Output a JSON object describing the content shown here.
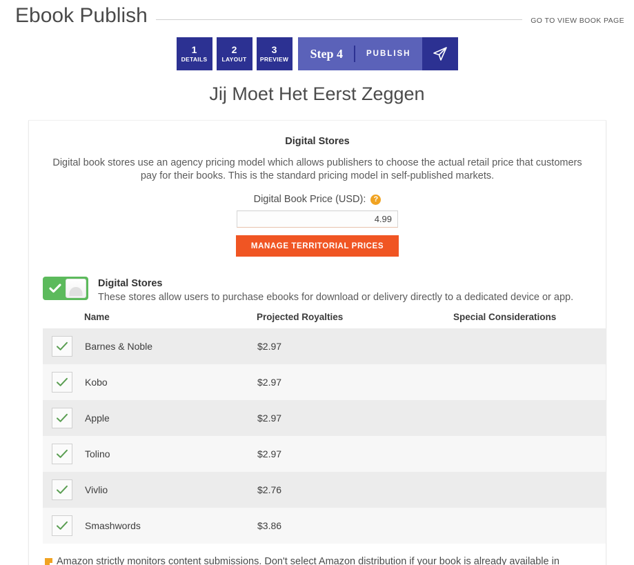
{
  "header": {
    "app_title": "Ebook Publish",
    "view_book_link": "GO TO VIEW BOOK PAGE"
  },
  "steps": {
    "items": [
      {
        "num": "1",
        "label": "DETAILS"
      },
      {
        "num": "2",
        "label": "LAYOUT"
      },
      {
        "num": "3",
        "label": "PREVIEW"
      }
    ],
    "active": {
      "word": "Step 4",
      "label": "PUBLISH",
      "icon": "paper-plane-icon"
    }
  },
  "book": {
    "title": "Jij Moet Het Eerst Zeggen"
  },
  "digital_stores_section": {
    "title": "Digital Stores",
    "description": "Digital book stores use an agency pricing model which allows publishers to choose the actual retail price that customers pay for their books. This is the standard pricing model in self-published markets.",
    "price_label": "Digital Book Price (USD):",
    "help_icon": "question-mark-icon",
    "price_value": "4.99",
    "price_placeholder": "0.00",
    "manage_button": "MANAGE TERRITORIAL PRICES"
  },
  "store_group": {
    "toggle_state": "on",
    "title": "Digital Stores",
    "subtitle": "These stores allow users to purchase ebooks for download or delivery directly to a dedicated device or app.",
    "columns": [
      "",
      "Name",
      "Projected Royalties",
      "Special Considerations"
    ],
    "rows": [
      {
        "checked": true,
        "name": "Barnes & Noble",
        "royalties": "$2.97",
        "special": ""
      },
      {
        "checked": true,
        "name": "Kobo",
        "royalties": "$2.97",
        "special": ""
      },
      {
        "checked": true,
        "name": "Apple",
        "royalties": "$2.97",
        "special": ""
      },
      {
        "checked": true,
        "name": "Tolino",
        "royalties": "$2.97",
        "special": ""
      },
      {
        "checked": true,
        "name": "Vivlio",
        "royalties": "$2.76",
        "special": ""
      },
      {
        "checked": true,
        "name": "Smashwords",
        "royalties": "$3.86",
        "special": ""
      }
    ]
  },
  "warning": {
    "icon": "orange-note-icon",
    "text": "Amazon strictly monitors content submissions. Don't select Amazon distribution if your book is already available in"
  },
  "colors": {
    "step_dark": "#2c3192",
    "step_light": "#5b62b9",
    "accent_orange": "#f05523",
    "help_orange": "#f0a322",
    "toggle_green": "#5cba5c",
    "check_green": "#5a9e52"
  }
}
